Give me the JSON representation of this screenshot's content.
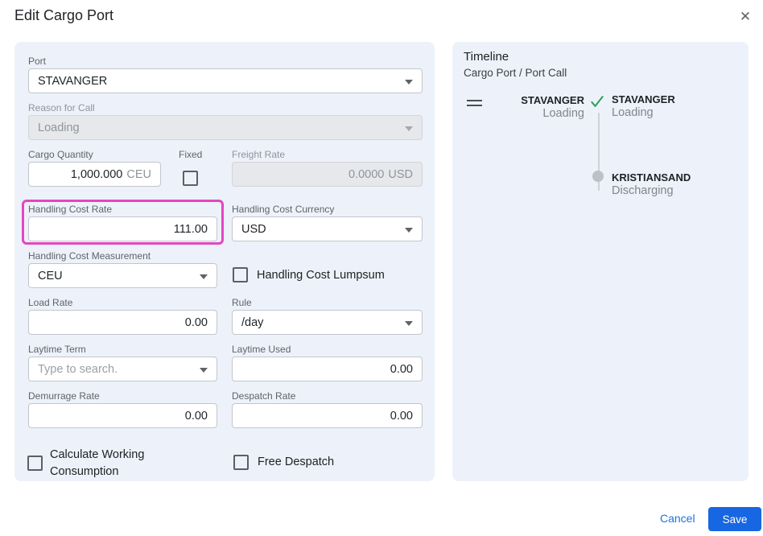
{
  "dialog": {
    "title": "Edit Cargo Port",
    "close_glyph": "✕"
  },
  "form": {
    "port": {
      "label": "Port",
      "value": "STAVANGER"
    },
    "reason_for_call": {
      "label": "Reason for Call",
      "value": "Loading",
      "disabled": true
    },
    "cargo_quantity": {
      "label": "Cargo Quantity",
      "value": "1,000.000",
      "unit": "CEU"
    },
    "fixed": {
      "label": "Fixed",
      "checked": false
    },
    "freight_rate": {
      "label": "Freight Rate",
      "value": "0.0000",
      "unit": "USD",
      "disabled": true
    },
    "handling_cost_rate": {
      "label": "Handling Cost Rate",
      "value": "111.00",
      "highlighted": true
    },
    "handling_cost_currency": {
      "label": "Handling Cost Currency",
      "value": "USD"
    },
    "handling_cost_measurement": {
      "label": "Handling Cost Measurement",
      "value": "CEU"
    },
    "handling_cost_lumpsum": {
      "label": "Handling Cost Lumpsum",
      "checked": false
    },
    "load_rate": {
      "label": "Load Rate",
      "value": "0.00"
    },
    "rule": {
      "label": "Rule",
      "value": "/day"
    },
    "laytime_term": {
      "label": "Laytime Term",
      "placeholder": "Type to search."
    },
    "laytime_used": {
      "label": "Laytime Used",
      "value": "0.00"
    },
    "demurrage_rate": {
      "label": "Demurrage Rate",
      "value": "0.00"
    },
    "despatch_rate": {
      "label": "Despatch Rate",
      "value": "0.00"
    },
    "calculate_working_consumption": {
      "label": "Calculate Working Consumption",
      "checked": false
    },
    "free_despatch": {
      "label": "Free Despatch",
      "checked": false
    }
  },
  "timeline": {
    "title": "Timeline",
    "subtitle": "Cargo Port / Port Call",
    "current": {
      "port": "STAVANGER",
      "action": "Loading"
    },
    "stops": [
      {
        "port": "STAVANGER",
        "action": "Loading",
        "status": "completed"
      },
      {
        "port": "KRISTIANSAND",
        "action": "Discharging",
        "status": "pending"
      }
    ]
  },
  "footer": {
    "cancel_label": "Cancel",
    "save_label": "Save"
  },
  "colors": {
    "highlight_magenta": "#e347c1",
    "save_blue": "#1766e2",
    "link_blue": "#1a73e8",
    "check_green": "#2e9e55",
    "panel_bg": "#edf2fa"
  }
}
